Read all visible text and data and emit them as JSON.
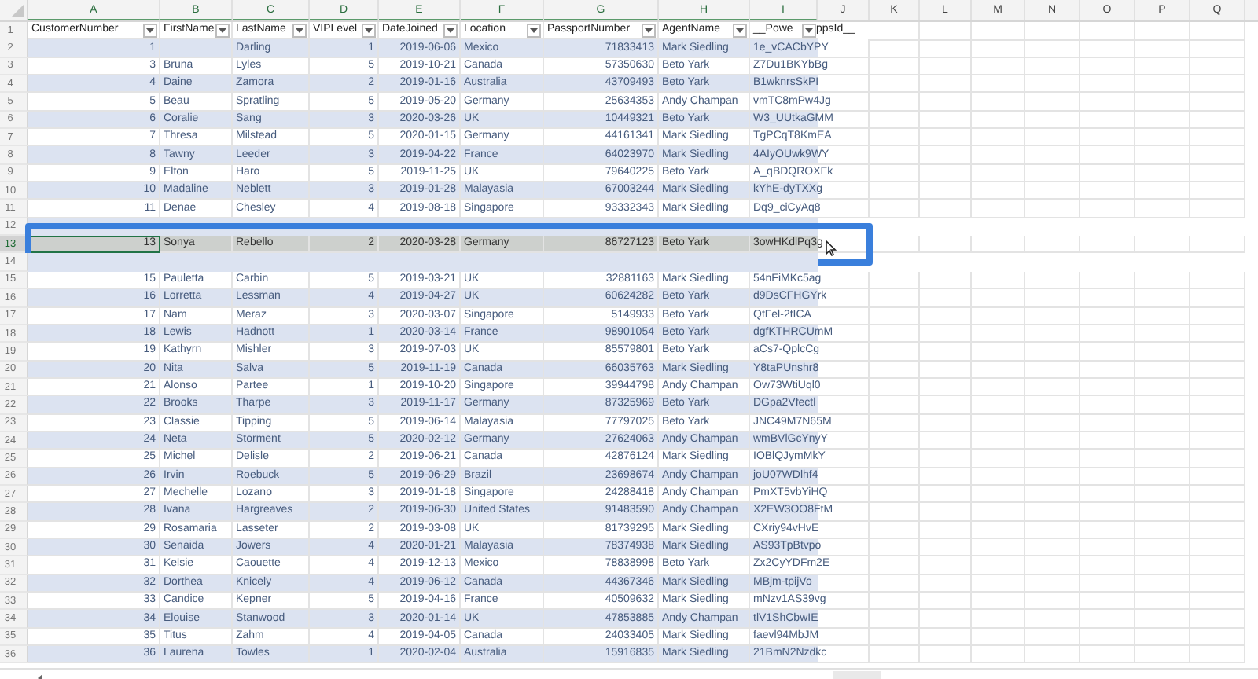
{
  "columns": [
    "A",
    "B",
    "C",
    "D",
    "E",
    "F",
    "G",
    "H",
    "I",
    "J",
    "K",
    "L",
    "M",
    "N",
    "O",
    "P",
    "Q"
  ],
  "header": {
    "n": "1",
    "titles": [
      {
        "title": "CustomerNumber"
      },
      {
        "title": "FirstName"
      },
      {
        "title": "LastName"
      },
      {
        "title": "VIPLevel"
      },
      {
        "title": "DateJoined"
      },
      {
        "title": "Location"
      },
      {
        "title": "PassportNumber"
      },
      {
        "title": "AgentName"
      },
      {
        "title": "__Powe",
        "overflow": "ppsId__"
      }
    ]
  },
  "rows": [
    {
      "n": "2",
      "selected": false,
      "cells": [
        "1",
        null,
        "Darling",
        "1",
        "2019-06-06",
        "Mexico",
        "71833413",
        "Mark Siedling",
        "1e_vCACbYPY"
      ]
    },
    {
      "n": "3",
      "selected": false,
      "cells": [
        "3",
        "Bruna",
        "Lyles",
        "5",
        "2019-10-21",
        "Canada",
        "57350630",
        "Beto Yark",
        "Z7Du1BKYbBg"
      ]
    },
    {
      "n": "4",
      "selected": false,
      "cells": [
        "4",
        "Daine",
        "Zamora",
        "2",
        "2019-01-16",
        "Australia",
        "43709493",
        "Beto Yark",
        "B1wknrsSkPI"
      ]
    },
    {
      "n": "5",
      "selected": false,
      "cells": [
        "5",
        "Beau",
        "Spratling",
        "5",
        "2019-05-20",
        "Germany",
        "25634353",
        "Andy Champan",
        "vmTC8mPw4Jg"
      ]
    },
    {
      "n": "6",
      "selected": false,
      "cells": [
        "6",
        "Coralie",
        "Sang",
        "3",
        "2020-03-26",
        "UK",
        "10449321",
        "Beto Yark",
        "W3_UUtkaGMM"
      ]
    },
    {
      "n": "7",
      "selected": false,
      "cells": [
        "7",
        "Thresa",
        "Milstead",
        "5",
        "2020-01-15",
        "Germany",
        "44161341",
        "Mark Siedling",
        "TgPCqT8KmEA"
      ]
    },
    {
      "n": "8",
      "selected": false,
      "cells": [
        "8",
        "Tawny",
        "Leeder",
        "3",
        "2019-04-22",
        "France",
        "64023970",
        "Mark Siedling",
        "4AIyOUwk9WY"
      ]
    },
    {
      "n": "9",
      "selected": false,
      "cells": [
        "9",
        "Elton",
        "Haro",
        "5",
        "2019-11-25",
        "UK",
        "79640225",
        "Beto Yark",
        "A_qBDQROXFk"
      ]
    },
    {
      "n": "10",
      "selected": false,
      "cells": [
        "10",
        "Madaline",
        "Neblett",
        "3",
        "2019-01-28",
        "Malayasia",
        "67003244",
        "Mark Siedling",
        "kYhE-dyTXXg"
      ]
    },
    {
      "n": "11",
      "selected": false,
      "cells": [
        "11",
        "Denae",
        "Chesley",
        "4",
        "2019-08-18",
        "Singapore",
        "93332343",
        "Mark Siedling",
        "Dq9_ciCyAq8"
      ]
    },
    {
      "n": "12",
      "selected": false
    },
    {
      "n": "13",
      "selected": true,
      "cells": [
        "13",
        "Sonya",
        "Rebello",
        "2",
        "2020-03-28",
        "Germany",
        "86727123",
        "Beto Yark",
        "3owHKdlPq3g"
      ]
    },
    {
      "n": "14",
      "selected": false
    },
    {
      "n": "15",
      "selected": false,
      "cells": [
        "15",
        "Pauletta",
        "Carbin",
        "5",
        "2019-03-21",
        "UK",
        "32881163",
        "Mark Siedling",
        "54nFiMKc5ag"
      ]
    },
    {
      "n": "16",
      "selected": false,
      "cells": [
        "16",
        "Lorretta",
        "Lessman",
        "4",
        "2019-04-27",
        "UK",
        "60624282",
        "Beto Yark",
        "d9DsCFHGYrk"
      ]
    },
    {
      "n": "17",
      "selected": false,
      "cells": [
        "17",
        "Nam",
        "Meraz",
        "3",
        "2020-03-07",
        "Singapore",
        "5149933",
        "Beto Yark",
        "QtFel-2tICA"
      ]
    },
    {
      "n": "18",
      "selected": false,
      "cells": [
        "18",
        "Lewis",
        "Hadnott",
        "1",
        "2020-03-14",
        "France",
        "98901054",
        "Beto Yark",
        "dgfKTHRCUmM"
      ]
    },
    {
      "n": "19",
      "selected": false,
      "cells": [
        "19",
        "Kathyrn",
        "Mishler",
        "3",
        "2019-07-03",
        "UK",
        "85579801",
        "Beto Yark",
        "aCs7-QplcCg"
      ]
    },
    {
      "n": "20",
      "selected": false,
      "cells": [
        "20",
        "Nita",
        "Salva",
        "5",
        "2019-11-19",
        "Canada",
        "66035763",
        "Mark Siedling",
        "Y8taPUnshr8"
      ]
    },
    {
      "n": "21",
      "selected": false,
      "cells": [
        "21",
        "Alonso",
        "Partee",
        "1",
        "2019-10-20",
        "Singapore",
        "39944798",
        "Andy Champan",
        "Ow73WtiUql0"
      ]
    },
    {
      "n": "22",
      "selected": false,
      "cells": [
        "22",
        "Brooks",
        "Tharpe",
        "3",
        "2019-11-17",
        "Germany",
        "87325969",
        "Beto Yark",
        "DGpa2Vfectl"
      ]
    },
    {
      "n": "23",
      "selected": false,
      "cells": [
        "23",
        "Classie",
        "Tipping",
        "5",
        "2019-06-14",
        "Malayasia",
        "77797025",
        "Beto Yark",
        "JNC49M7N65M"
      ]
    },
    {
      "n": "24",
      "selected": false,
      "cells": [
        "24",
        "Neta",
        "Storment",
        "5",
        "2020-02-12",
        "Germany",
        "27624063",
        "Andy Champan",
        "wmBVlGcYnyY"
      ]
    },
    {
      "n": "25",
      "selected": false,
      "cells": [
        "25",
        "Michel",
        "Delisle",
        "2",
        "2019-06-21",
        "Canada",
        "42876124",
        "Mark Siedling",
        "IOBlQJymMkY"
      ]
    },
    {
      "n": "26",
      "selected": false,
      "cells": [
        "26",
        "Irvin",
        "Roebuck",
        "5",
        "2019-06-29",
        "Brazil",
        "23698674",
        "Andy Champan",
        "joU07WDlhf4"
      ]
    },
    {
      "n": "27",
      "selected": false,
      "cells": [
        "27",
        "Mechelle",
        "Lozano",
        "3",
        "2019-01-18",
        "Singapore",
        "24288418",
        "Andy Champan",
        "PmXT5vbYiHQ"
      ]
    },
    {
      "n": "28",
      "selected": false,
      "cells": [
        "28",
        "Ivana",
        "Hargreaves",
        "2",
        "2019-06-30",
        "United States",
        "91483590",
        "Andy Champan",
        "X2EW3OO8FtM"
      ]
    },
    {
      "n": "29",
      "selected": false,
      "cells": [
        "29",
        "Rosamaria",
        "Lasseter",
        "2",
        "2019-03-08",
        "UK",
        "81739295",
        "Mark Siedling",
        "CXriy94vHvE"
      ]
    },
    {
      "n": "30",
      "selected": false,
      "cells": [
        "30",
        "Senaida",
        "Jowers",
        "4",
        "2020-01-21",
        "Malayasia",
        "78374938",
        "Mark Siedling",
        "AS93TpBtvpo"
      ]
    },
    {
      "n": "31",
      "selected": false,
      "cells": [
        "31",
        "Kelsie",
        "Caouette",
        "4",
        "2019-12-13",
        "Mexico",
        "78838998",
        "Beto Yark",
        "Zx2CyYDFm2E"
      ]
    },
    {
      "n": "32",
      "selected": false,
      "cells": [
        "32",
        "Dorthea",
        "Knicely",
        "4",
        "2019-06-12",
        "Canada",
        "44367346",
        "Mark Siedling",
        "MBjm-tpijVo"
      ]
    },
    {
      "n": "33",
      "selected": false,
      "cells": [
        "33",
        "Candice",
        "Kepner",
        "5",
        "2019-04-16",
        "France",
        "40509632",
        "Mark Siedling",
        "mNzv1AS39vg"
      ]
    },
    {
      "n": "34",
      "selected": false,
      "cells": [
        "34",
        "Elouise",
        "Stanwood",
        "3",
        "2020-01-14",
        "UK",
        "47853885",
        "Andy Champan",
        "tlV1ShCbwIE"
      ]
    },
    {
      "n": "35",
      "selected": false,
      "cells": [
        "35",
        "Titus",
        "Zahm",
        "4",
        "2019-04-05",
        "Canada",
        "24033405",
        "Mark Siedling",
        "faevl94MbJM"
      ]
    },
    {
      "n": "36",
      "selected": false,
      "cells": [
        "36",
        "Laurena",
        "Towles",
        "1",
        "2020-02-04",
        "Australia",
        "15916835",
        "Mark Siedling",
        "21BmN2Nzdkc"
      ]
    }
  ]
}
